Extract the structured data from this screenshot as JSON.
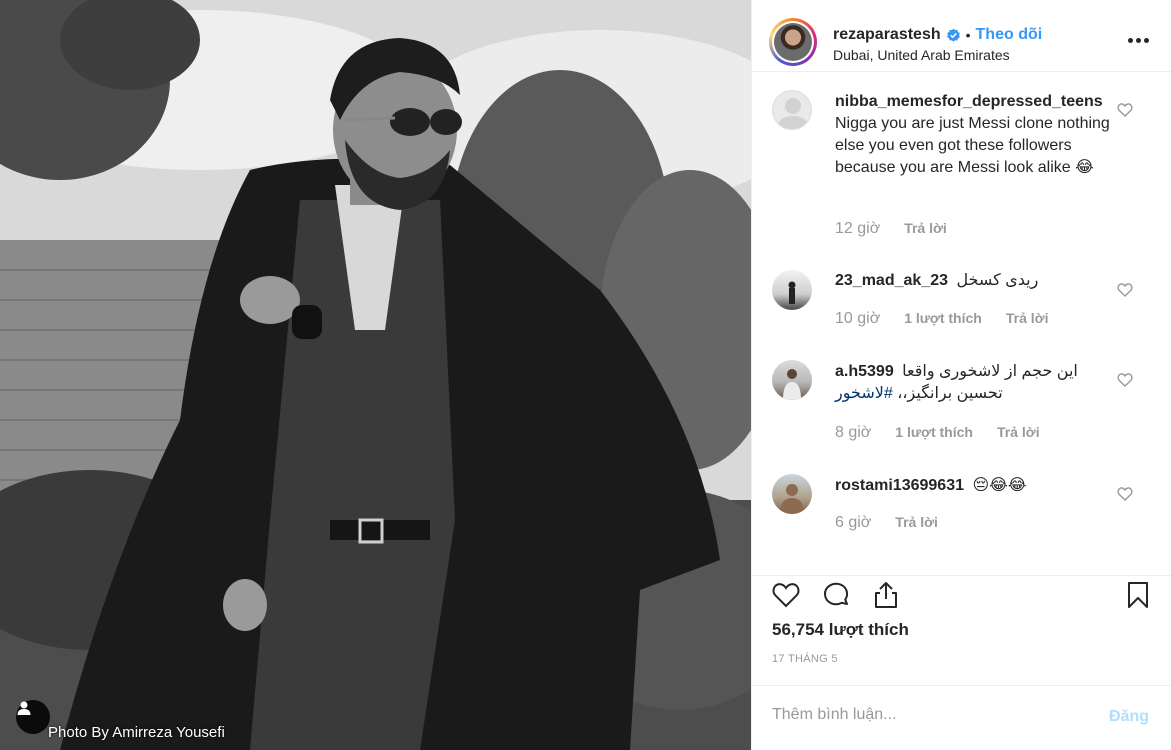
{
  "photo": {
    "credit": "Photo By Amirreza Yousefi"
  },
  "header": {
    "username": "rezaparastesh",
    "separator": "•",
    "follow_label": "Theo dõi",
    "location": "Dubai, United Arab Emirates"
  },
  "comments": [
    {
      "user": "nibba_memesfor_depressed_teens",
      "text": "Nigga you are just Messi clone nothing else you even got these followers because you are Messi look alike 😂",
      "time": "12 giờ",
      "likes": "",
      "reply": "Trả lời"
    },
    {
      "user": "23_mad_ak_23",
      "text": "ریدی کسخل",
      "time": "10 giờ",
      "likes": "1 lượt thích",
      "reply": "Trả lời"
    },
    {
      "user": "a.h5399",
      "text": "این حجم از لاشخوری واقعا تحسین برانگیز،،",
      "hashtag": "#لاشخور",
      "time": "8 giờ",
      "likes": "1 lượt thích",
      "reply": "Trả lời"
    },
    {
      "user": "rostami13699631",
      "text": "😔😂😂",
      "time": "6 giờ",
      "likes": "",
      "reply": "Trả lời"
    }
  ],
  "actions": {
    "likes": "56,754 lượt thích",
    "date": "17 THÁNG 5"
  },
  "add_comment": {
    "placeholder": "Thêm bình luận...",
    "post_label": "Đăng"
  },
  "colors": {
    "accent": "#3897f0",
    "muted": "#999999",
    "post_disabled": "#b2dffc"
  }
}
